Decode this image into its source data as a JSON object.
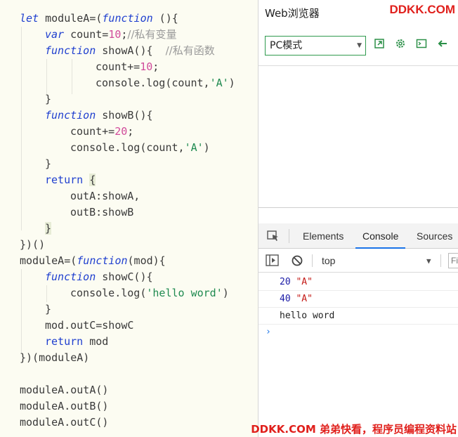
{
  "editor": {
    "lines": [
      "let moduleA=(function (){",
      "var count=10;//私有变量",
      "function showA(){  //私有函数",
      "count+=10;",
      "console.log(count,'A')",
      "}",
      "function showB(){",
      "count+=20;",
      "console.log(count,'A')",
      "}",
      "return {",
      "outA:showA,",
      "outB:showB",
      "}",
      "})()",
      "moduleA=(function(mod){",
      "function showC(){",
      "console.log('hello word')",
      "}",
      "mod.outC=showC",
      "return mod",
      "})(moduleA)",
      "",
      "moduleA.outA()",
      "moduleA.outB()",
      "moduleA.outC()"
    ]
  },
  "browser": {
    "title": "Web浏览器",
    "brand": "DDKK.COM",
    "mode_select": "PC模式",
    "icons": [
      "open-external-icon",
      "settings-gear-icon",
      "terminal-icon",
      "back-arrow-icon"
    ]
  },
  "devtools": {
    "tabs": [
      "Elements",
      "Console",
      "Sources"
    ],
    "active_tab": "Console",
    "context": "top",
    "filter_placeholder": "Fi",
    "logs": [
      {
        "num": "20",
        "str": "\"A\""
      },
      {
        "num": "40",
        "str": "\"A\""
      },
      {
        "text": "hello word"
      }
    ],
    "prompt": "›"
  },
  "footer": {
    "brand": "DDKK.COM 弟弟快看，程序员编程资料站"
  },
  "colors": {
    "keyword": "#1f3fcf",
    "number": "#d14b9b",
    "string": "#1f8a50",
    "comment": "#9a9a9a",
    "accent": "#2a8f47",
    "brand": "#e0201c",
    "tab_underline": "#1a73e8"
  }
}
